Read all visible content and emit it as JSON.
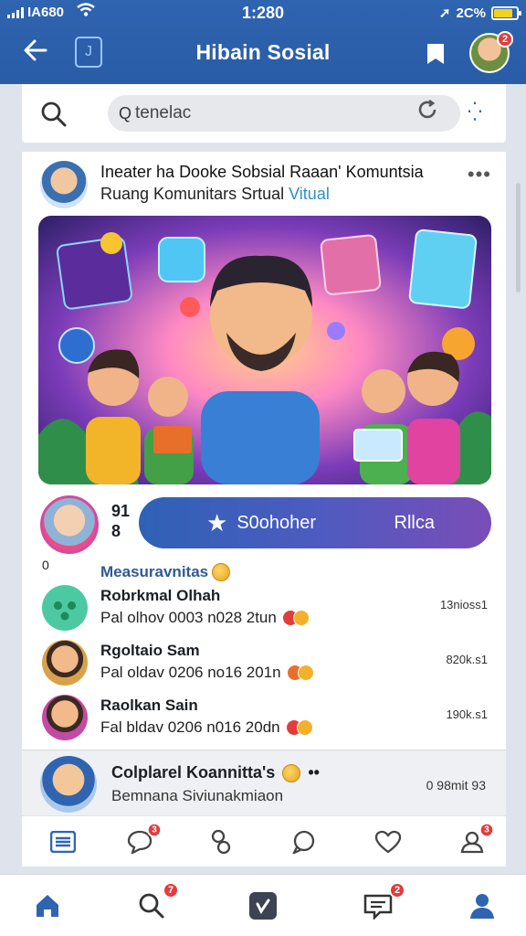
{
  "status_bar": {
    "carrier": "IA680",
    "time": "1:280",
    "battery_text": "2C%",
    "battery_level": 0.85
  },
  "header": {
    "title": "Hibain Sosial",
    "avatar_badge": "2"
  },
  "search": {
    "value": "tenelac"
  },
  "post": {
    "title": "Ineater ha Dooke Sobsial Raaan' Komuntsia",
    "subtitle": "Ruang Komunitars Srtual",
    "subtitle_tag": "Vitual",
    "more": "•••"
  },
  "action": {
    "count_a": "91",
    "count_b": "8",
    "zero": "0",
    "button_left": "S0ohoher",
    "button_right": "Rllca"
  },
  "members_section": {
    "label": "Measuravnitas",
    "items": [
      {
        "name": "Robrkmal Olhah",
        "meta": "Pal olhov 0003 n028 2tun",
        "right": "13nioss1"
      },
      {
        "name": "Rgoltaio Sam",
        "meta": "Pal oldav 0206 no16 201n",
        "right": "820k.s1"
      },
      {
        "name": "Raolkan Sain",
        "meta": "Fal bldav 0206 n016 20dn",
        "right": "190k.s1"
      }
    ]
  },
  "community": {
    "name": "Colplarel Koannitta's",
    "dots": "••",
    "sub": "Bemnana Siviunakmiaon",
    "right": "0 98mit 93"
  },
  "subtabs": {
    "badge_1": "3",
    "badge_2": "3"
  },
  "tabbar": {
    "badge_search": "7",
    "badge_inbox": "2"
  },
  "colors": {
    "brand": "#2f64b0",
    "accent_purple": "#7a4db7",
    "badge": "#e23c3c"
  }
}
